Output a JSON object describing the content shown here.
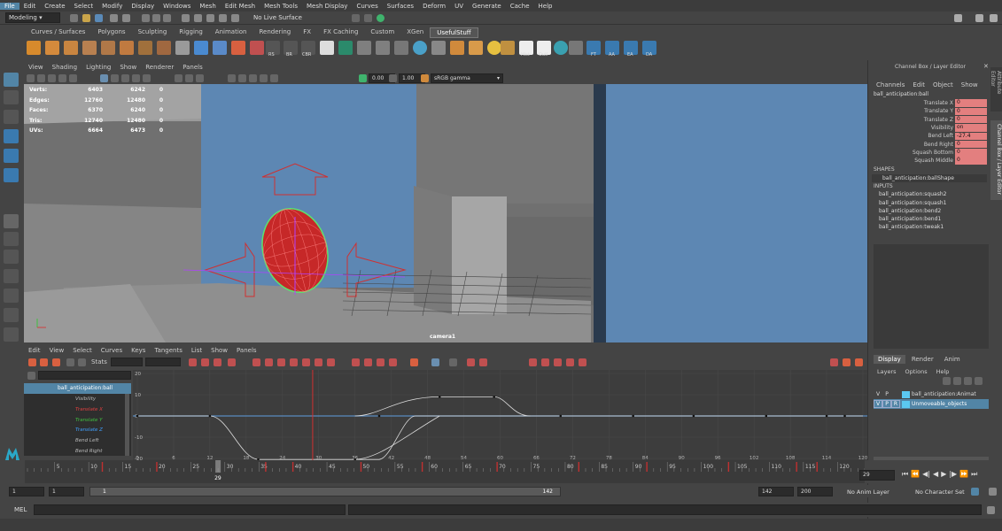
{
  "menu": [
    "File",
    "Edit",
    "Create",
    "Select",
    "Modify",
    "Display",
    "Windows",
    "Mesh",
    "Edit Mesh",
    "Mesh Tools",
    "Mesh Display",
    "Curves",
    "Surfaces",
    "Deform",
    "UV",
    "Generate",
    "Cache",
    "Help"
  ],
  "status": {
    "mode": "Modeling",
    "live_surface": "No Live Surface"
  },
  "shelf_tabs": [
    "Curves / Surfaces",
    "Polygons",
    "Sculpting",
    "Rigging",
    "Animation",
    "Rendering",
    "FX",
    "FX Caching",
    "Custom",
    "XGen",
    "UsefulStuff"
  ],
  "shelf_labels": [
    "RS",
    "BR",
    "CBR",
    "Hist",
    "Outl",
    "FT",
    "AA",
    "EA",
    "DA"
  ],
  "viewport": {
    "menu": [
      "View",
      "Shading",
      "Lighting",
      "Show",
      "Renderer",
      "Panels"
    ],
    "exposure": "0.00",
    "gamma": "1.00",
    "colorspace": "sRGB gamma",
    "hud": [
      [
        "Verts:",
        "6403",
        "6242",
        "0"
      ],
      [
        "Edges:",
        "12760",
        "12480",
        "0"
      ],
      [
        "Faces:",
        "6370",
        "6240",
        "0"
      ],
      [
        "Tris:",
        "12740",
        "12480",
        "0"
      ],
      [
        "UVs:",
        "6664",
        "6473",
        "0"
      ]
    ],
    "camera": "camera1"
  },
  "graph_editor": {
    "menu": [
      "Edit",
      "View",
      "Select",
      "Curves",
      "Keys",
      "Tangents",
      "List",
      "Show",
      "Panels"
    ],
    "stats_label": "Stats",
    "outliner_node": "ball_anticipation:ball",
    "channels": [
      "Visibility",
      "Translate X",
      "Translate Y",
      "Translate Z",
      "Bend Left",
      "Bend Right"
    ],
    "y_labels": [
      "20",
      "10",
      "0",
      "-10",
      "-20"
    ],
    "x_labels": [
      "0",
      "6",
      "12",
      "18",
      "24",
      "30",
      "36",
      "42",
      "48",
      "54",
      "60",
      "66",
      "72",
      "78",
      "84",
      "90",
      "96",
      "102",
      "108",
      "114",
      "120"
    ]
  },
  "channel_box": {
    "title": "Channel Box / Layer Editor",
    "menu": [
      "Channels",
      "Edit",
      "Object",
      "Show"
    ],
    "object": "ball_anticipation:ball",
    "attrs": [
      [
        "Translate X",
        "0"
      ],
      [
        "Translate Y",
        "0"
      ],
      [
        "Translate Z",
        "0"
      ],
      [
        "Visibility",
        "on"
      ],
      [
        "Bend Left",
        "-27.4"
      ],
      [
        "Bend Right",
        "0"
      ],
      [
        "Squash Bottom",
        "0"
      ],
      [
        "Squash Middle",
        "0"
      ]
    ],
    "shapes_header": "SHAPES",
    "shape": "ball_anticipation:ballShape",
    "inputs_header": "INPUTS",
    "inputs": [
      "ball_anticipation:squash2",
      "ball_anticipation:squash1",
      "ball_anticipation:bend2",
      "ball_anticipation:bend1",
      "ball_anticipation:tweak1"
    ],
    "side_tabs": [
      "Attribute Editor",
      "Channel Box / Layer Editor"
    ]
  },
  "layer_editor": {
    "tabs": [
      "Display",
      "Render",
      "Anim"
    ],
    "menu": [
      "Layers",
      "Options",
      "Help"
    ],
    "layers": [
      {
        "v": "V",
        "p": "P",
        "r": "",
        "name": "ball_anticipation:Animat",
        "color": "#5bc8f0"
      },
      {
        "v": "V",
        "p": "P",
        "r": "R",
        "name": "Unmoveable_objects",
        "color": "#5bc8f0"
      }
    ]
  },
  "timeline": {
    "ticks": [
      "5",
      "10",
      "15",
      "20",
      "25",
      "30",
      "35",
      "40",
      "45",
      "50",
      "55",
      "60",
      "65",
      "70",
      "75",
      "80",
      "85",
      "90",
      "95",
      "100",
      "105",
      "110",
      "115",
      "120"
    ],
    "current": "29",
    "current_field": "29"
  },
  "range": {
    "start": "1",
    "start2": "1",
    "slider_start": "1",
    "slider_end": "142",
    "end": "142",
    "end2": "200",
    "anim_layer": "No Anim Layer",
    "char_set": "No Character Set"
  },
  "cmd_label": "MEL"
}
